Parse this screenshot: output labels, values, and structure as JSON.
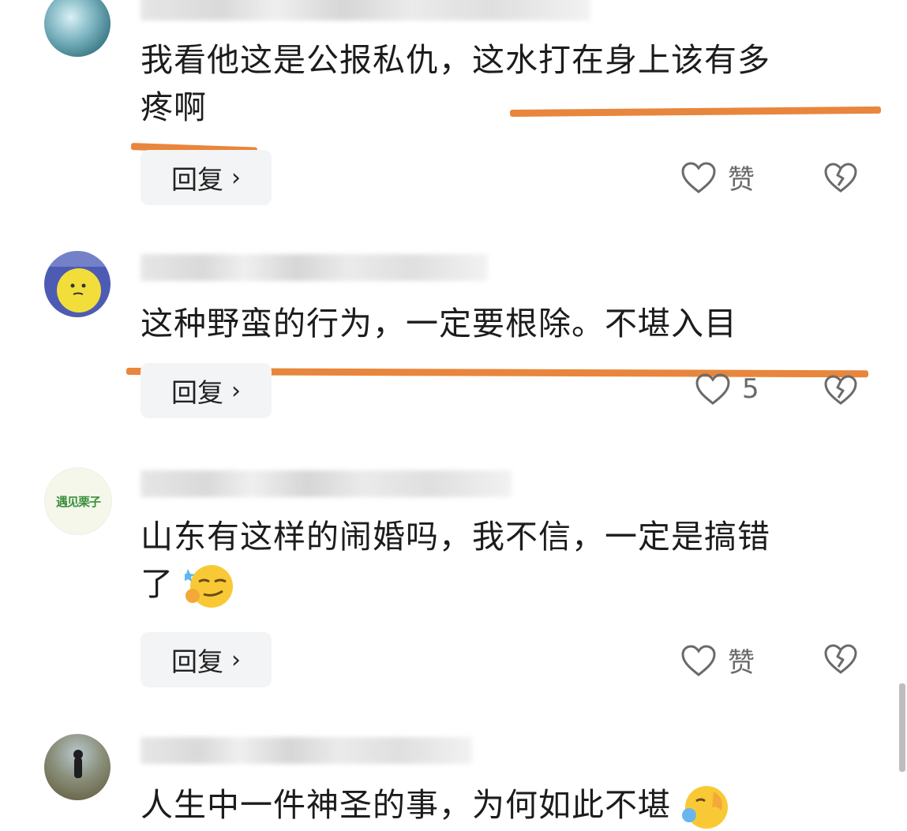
{
  "comments": [
    {
      "text_line1": "我看他这是公报私仇，这水打在身上该有多",
      "text_line2": "疼啊",
      "reply_label": "回复",
      "reply_chevron": "›",
      "like_label": "赞"
    },
    {
      "text_line1": "这种野蛮的行为，一定要根除。不堪入目",
      "reply_label": "回复",
      "reply_chevron": "›",
      "like_count": "5"
    },
    {
      "text_line1": "山东有这样的闹婚吗，我不信，一定是搞错",
      "text_line2": "了",
      "reply_label": "回复",
      "reply_chevron": "›",
      "like_label": "赞",
      "emoji": "smirking-face-emoji"
    },
    {
      "text_line1": "人生中一件神圣的事，为何如此不堪",
      "emoji": "face-with-hand-emoji"
    }
  ],
  "avatars": {
    "3": {
      "text": "遇见栗子"
    }
  },
  "colors": {
    "underline": "#e8863d",
    "reply_bg": "#f3f4f5",
    "icon_gray": "#6a6a6a"
  }
}
